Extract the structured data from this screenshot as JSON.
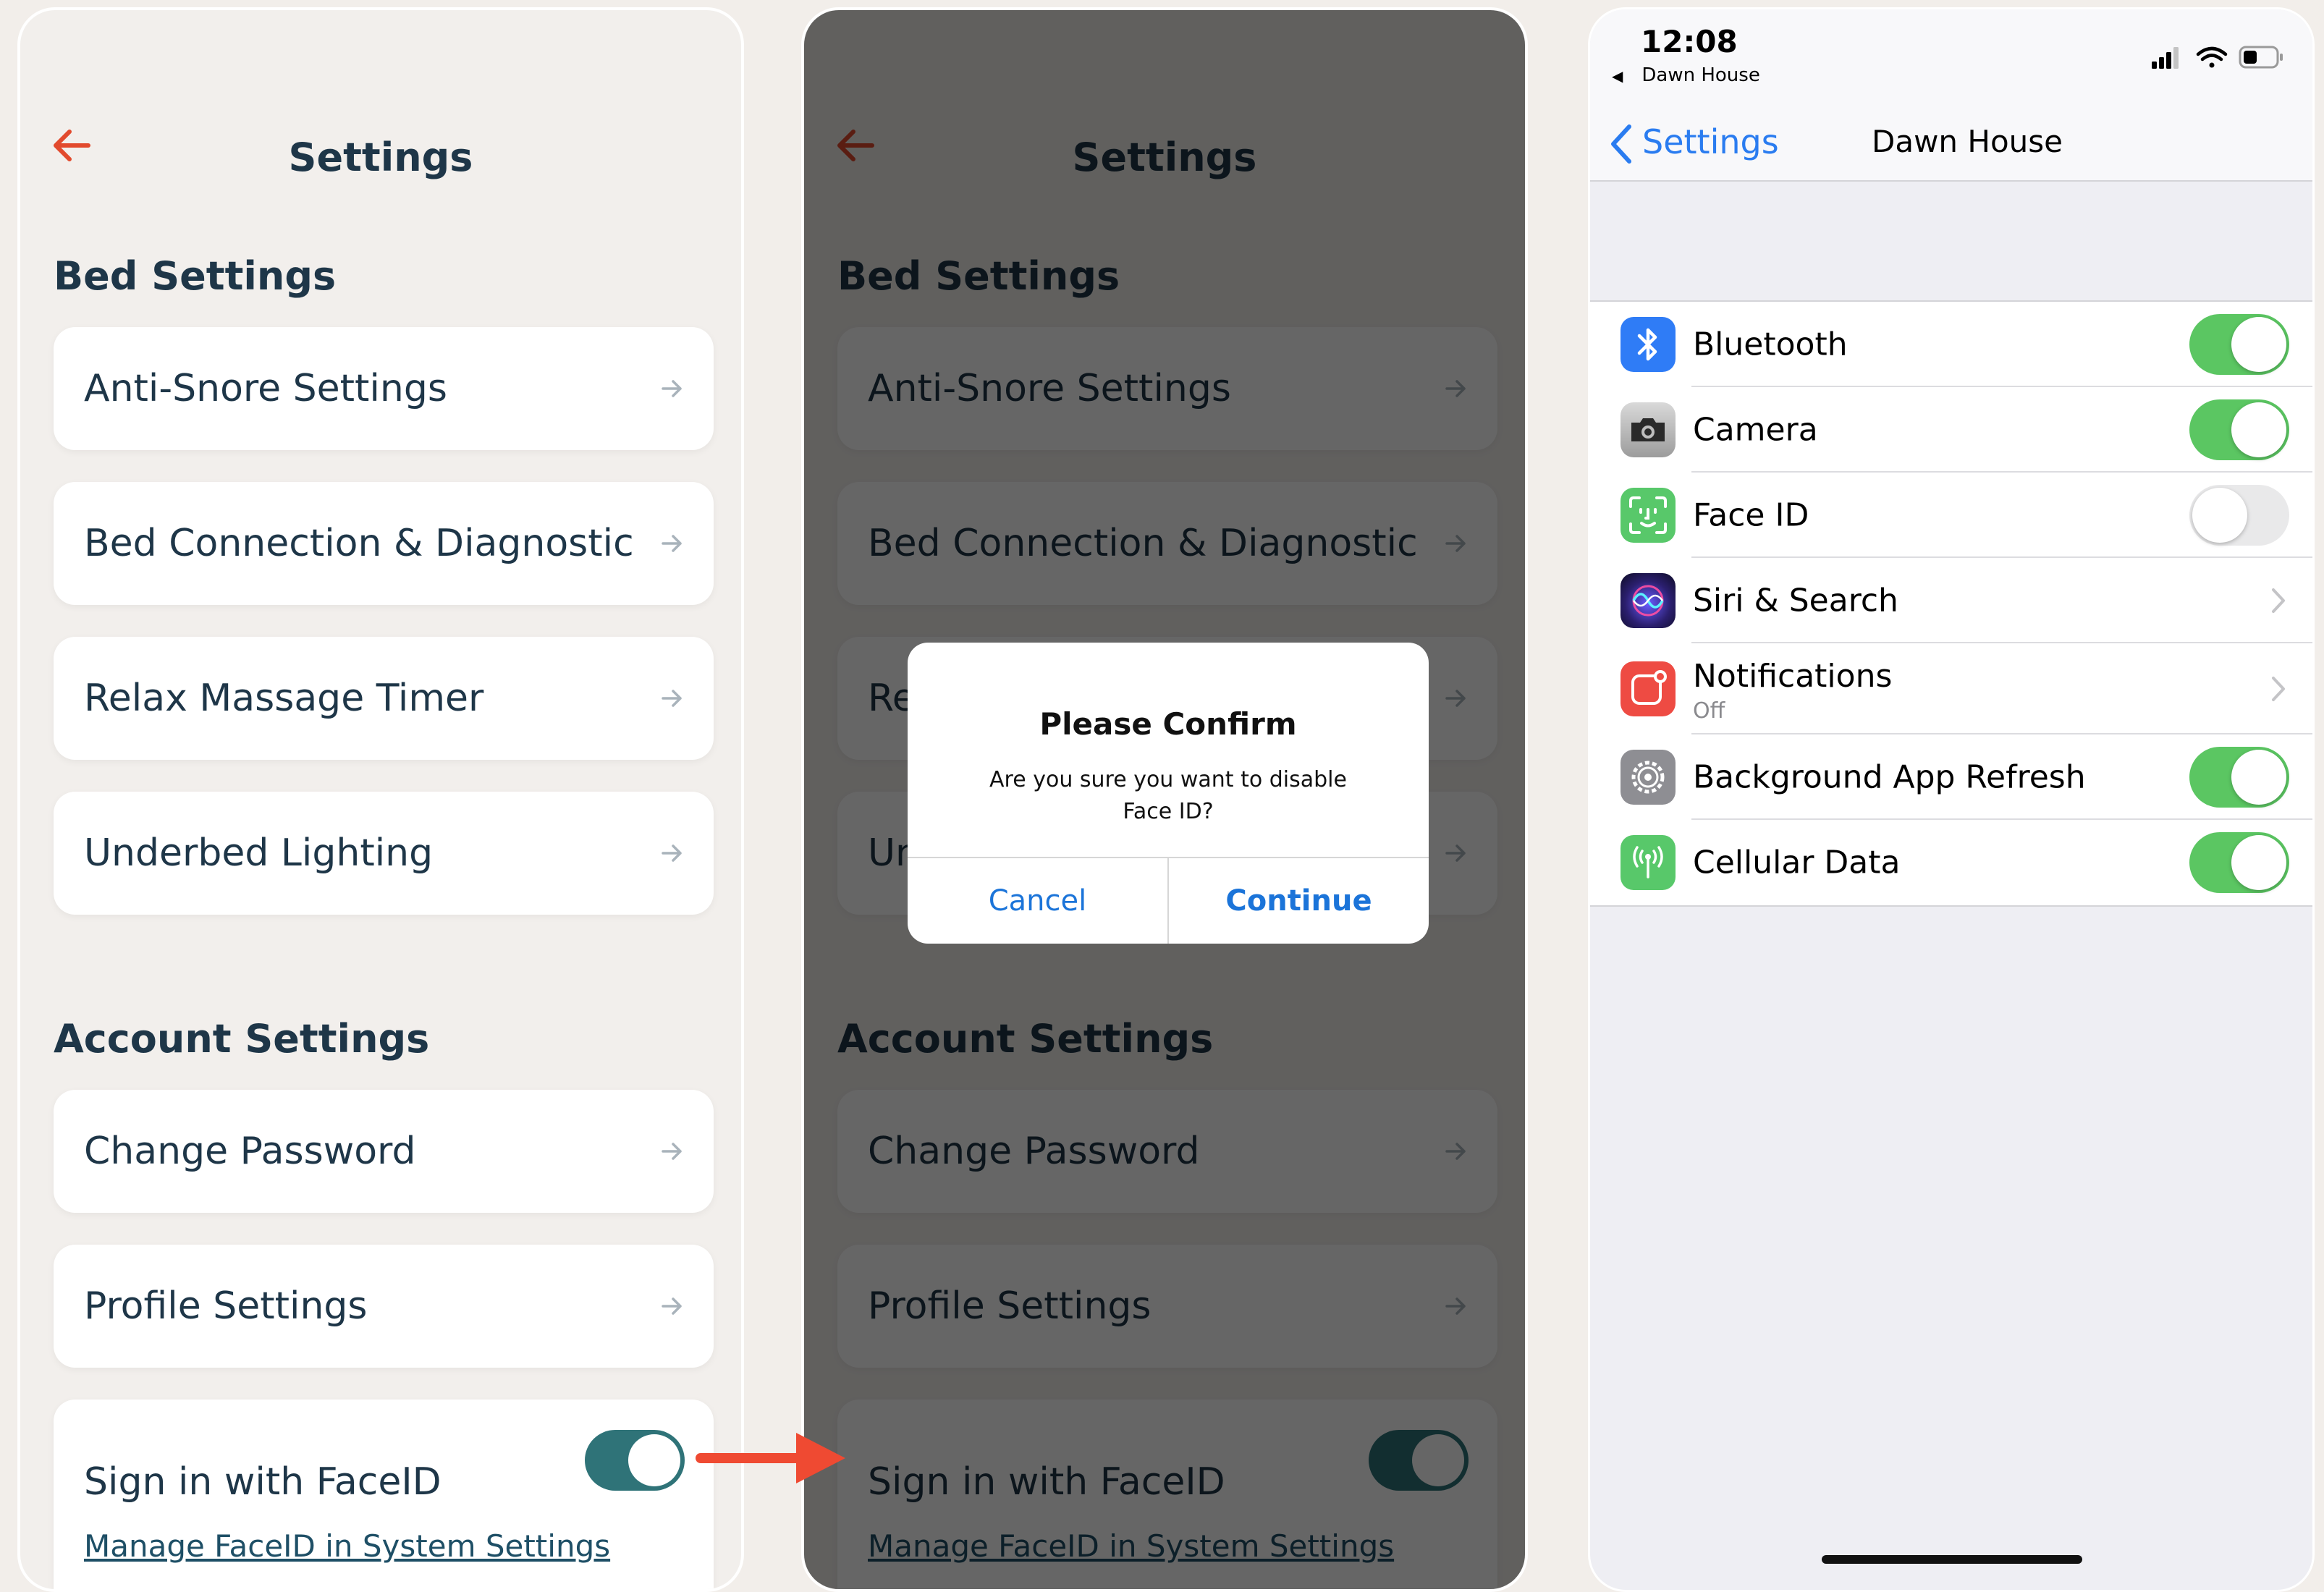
{
  "app": {
    "title": "Settings",
    "bed_section_title": "Bed Settings",
    "bed_items": [
      {
        "label": "Anti-Snore Settings"
      },
      {
        "label": "Bed Connection & Diagnostic"
      },
      {
        "label": "Relax Massage Timer"
      },
      {
        "label": "Underbed Lighting"
      }
    ],
    "account_section_title": "Account Settings",
    "account_items": [
      {
        "label": "Change Password"
      },
      {
        "label": "Profile Settings"
      }
    ],
    "faceid": {
      "label": "Sign in with FaceID",
      "link": "Manage FaceID in System Settings",
      "enabled": true
    },
    "colors": {
      "accent_red": "#e24a2d",
      "text_navy": "#1e3648",
      "toggle_teal": "#2f7378"
    }
  },
  "dialog": {
    "title": "Please Confirm",
    "message": "Are you sure you want to disable Face ID?",
    "cancel_label": "Cancel",
    "continue_label": "Continue"
  },
  "ios": {
    "status_time": "12:08",
    "status_back": "Dawn House",
    "nav_back_label": "Settings",
    "nav_title": "Dawn House",
    "rows": [
      {
        "label": "Bluetooth",
        "icon": "bluetooth-icon",
        "control": "toggle",
        "on": true
      },
      {
        "label": "Camera",
        "icon": "camera-icon",
        "control": "toggle",
        "on": true
      },
      {
        "label": "Face ID",
        "icon": "face-id-icon",
        "control": "toggle",
        "on": false
      },
      {
        "label": "Siri & Search",
        "icon": "siri-icon",
        "control": "chevron"
      },
      {
        "label": "Notifications",
        "sub": "Off",
        "icon": "notifications-icon",
        "control": "chevron"
      },
      {
        "label": "Background App Refresh",
        "icon": "gear-icon",
        "control": "toggle",
        "on": true
      },
      {
        "label": "Cellular Data",
        "icon": "antenna-icon",
        "control": "toggle",
        "on": true
      }
    ],
    "colors": {
      "toggle_on": "#5bc662",
      "link_blue": "#2a7cf0"
    }
  }
}
